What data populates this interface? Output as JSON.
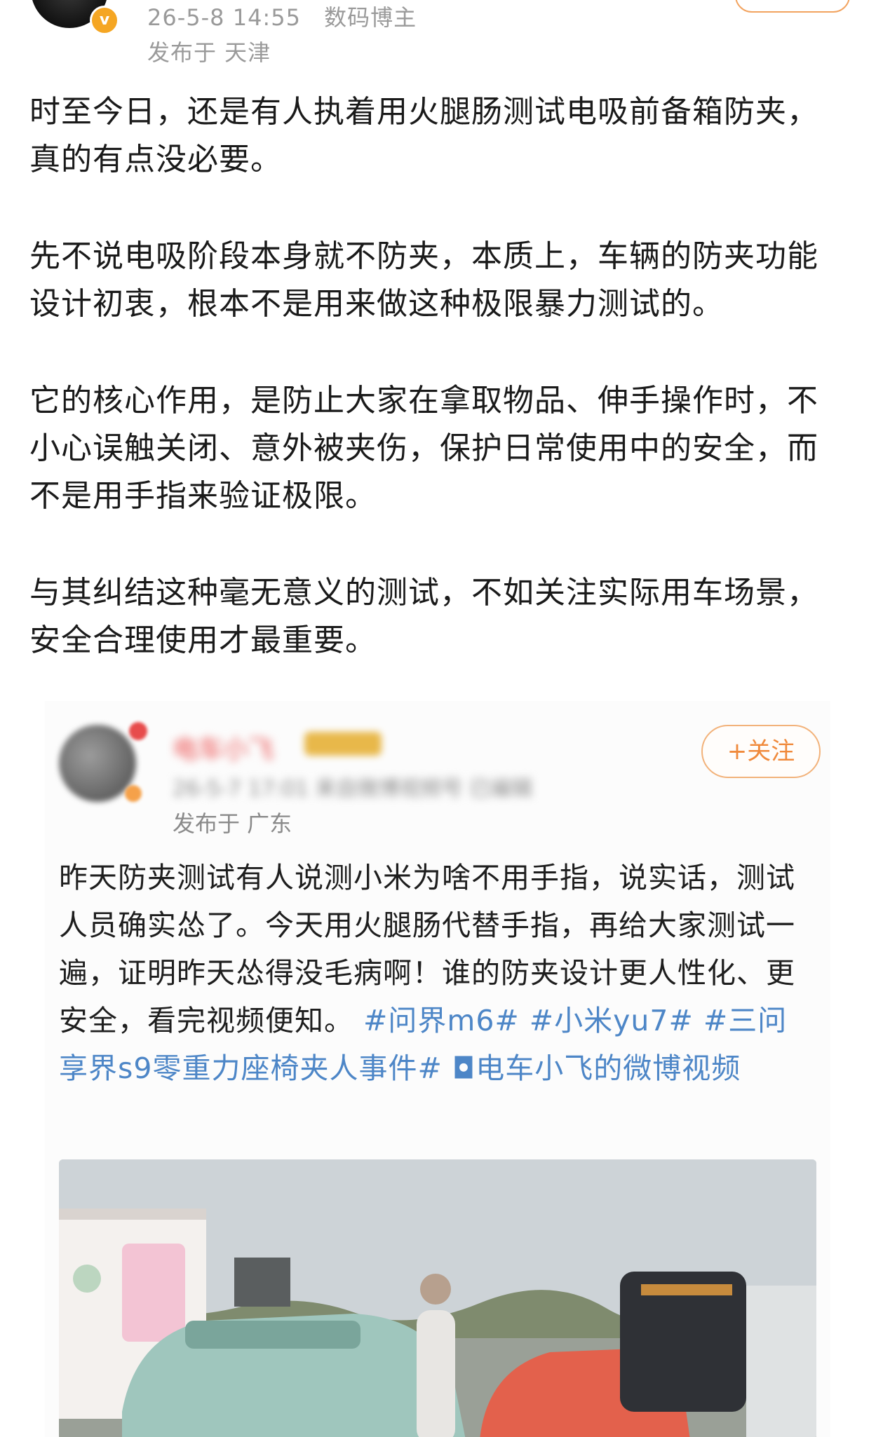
{
  "header": {
    "timestamp": "26-5-8 14:55",
    "role": "数码博主",
    "location": "发布于 天津",
    "verified_mark": "v"
  },
  "post": {
    "paragraphs": [
      "时至今日，还是有人执着用火腿肠测试电吸前备箱防夹，真的有点没必要。",
      "先不说电吸阶段本身就不防夹，本质上，车辆的防夹功能设计初衷，根本不是用来做这种极限暴力测试的。",
      "它的核心作用，是防止大家在拿取物品、伸手操作时，不小心误触关闭、意外被夹伤，保护日常使用中的安全，而不是用手指来验证极限。",
      "与其纠结这种毫无意义的测试，不如关注实际用车场景，安全合理使用才最重要。"
    ]
  },
  "quoted": {
    "name": "电车小飞",
    "meta": "26-5-7 17:01 来自微博视频号 已编辑",
    "follow_label": "+关注",
    "location": "发布于 广东",
    "text": "昨天防夹测试有人说测小米为啥不用手指，说实话，测试人员确实怂了。今天用火腿肠代替手指，再给大家测试一遍，证明昨天怂得没毛病啊！谁的防夹设计更人性化、更安全，看完视频便知。",
    "tags": "#问界m6# #小米yu7# #三问享界s9零重力座椅夹人事件# ◘电车小飞的微博视频"
  },
  "colors": {
    "meta_gray": "#9a9a9a",
    "link_blue": "#4d86c7",
    "follow_orange": "#f08a3c"
  }
}
